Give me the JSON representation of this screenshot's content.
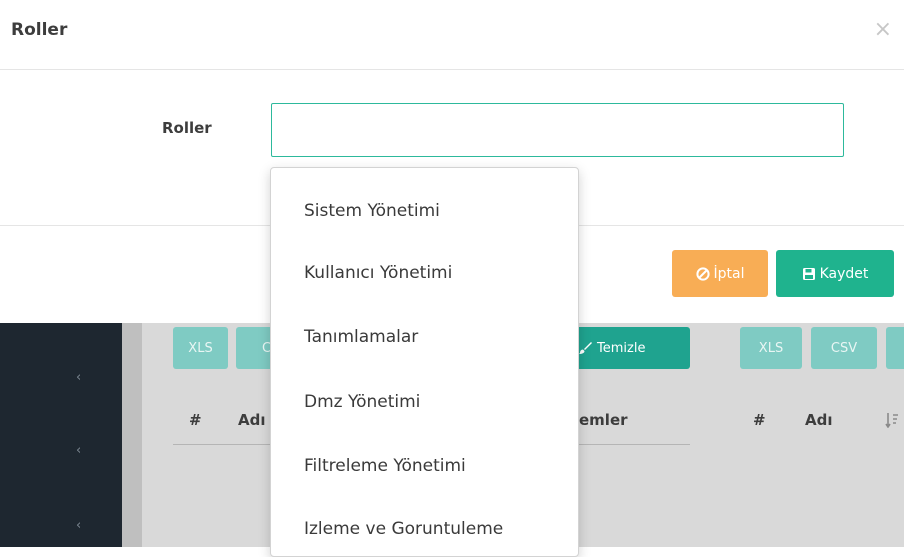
{
  "modal": {
    "title": "Roller",
    "close_label": "×",
    "field_label": "Roller",
    "field_value": "",
    "cancel_label": "İptal",
    "save_label": "Kaydet",
    "cancel_icon": "ban-icon",
    "save_icon": "floppy-disk-icon",
    "accent_color": "#2db99c",
    "cancel_color": "#f8ad55",
    "save_color": "#1fb38e"
  },
  "dropdown": {
    "options": [
      "Sistem Yönetimi",
      "Kullanıcı Yönetimi",
      "Tanımlamalar",
      "Dmz Yönetimi",
      "Filtreleme Yönetimi",
      "Izleme ve Goruntuleme"
    ]
  },
  "background": {
    "sidebar_chevron": "‹",
    "left_table": {
      "buttons": [
        "XLS",
        "C",
        "Temizle"
      ],
      "headers": [
        "#",
        "Adı",
        "emler"
      ]
    },
    "right_table": {
      "buttons": [
        "XLS",
        "CSV"
      ],
      "headers": [
        "#",
        "Adı"
      ]
    }
  }
}
